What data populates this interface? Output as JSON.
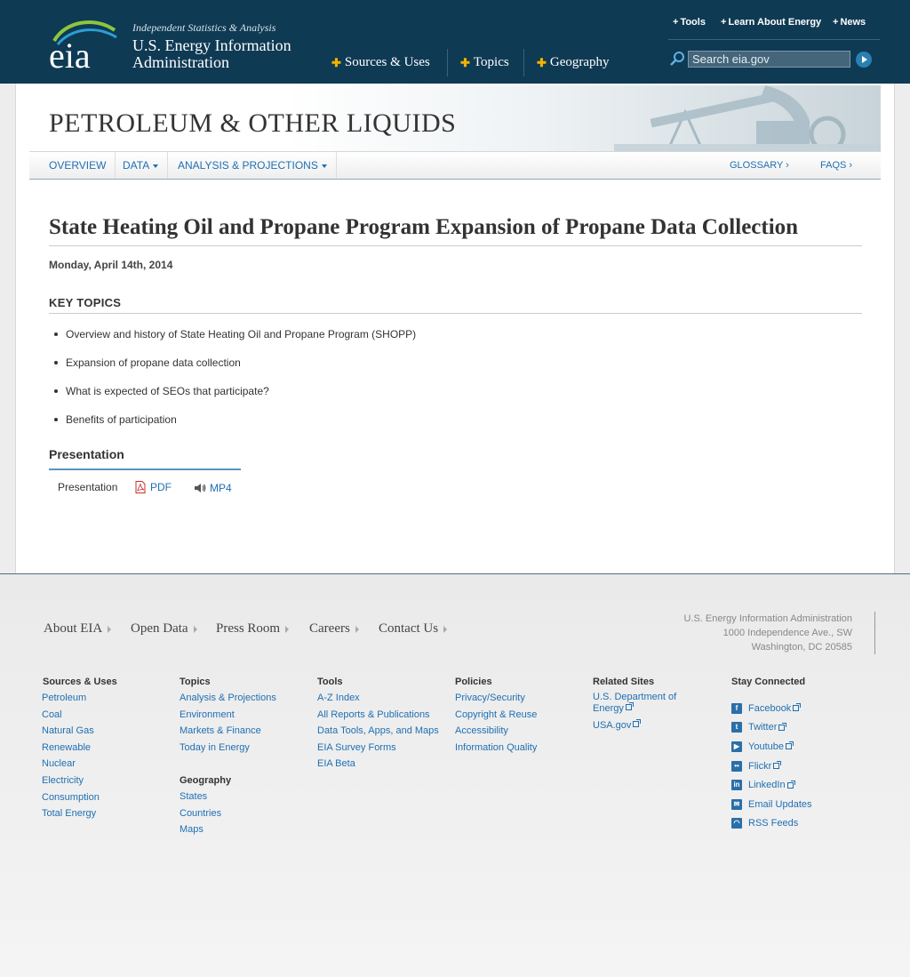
{
  "header": {
    "tagline": "Independent Statistics & Analysis",
    "org_name": "U.S. Energy Information Administration",
    "logo_text": "eia",
    "main_nav": [
      {
        "label": "Sources & Uses"
      },
      {
        "label": "Topics"
      },
      {
        "label": "Geography"
      }
    ],
    "top_links": [
      {
        "label": "Tools"
      },
      {
        "label": "Learn About Energy"
      },
      {
        "label": "News"
      }
    ],
    "search": {
      "placeholder": "Search eia.gov"
    }
  },
  "banner": {
    "title": "PETROLEUM & OTHER LIQUIDS"
  },
  "subnav": {
    "items": [
      {
        "label": "OVERVIEW"
      },
      {
        "label": "DATA"
      },
      {
        "label": "ANALYSIS & PROJECTIONS"
      }
    ],
    "glossary": "GLOSSARY ›",
    "faqs": "FAQS ›"
  },
  "article": {
    "title": "State Heating Oil and Propane Program Expansion of Propane Data Collection",
    "date": "Monday, April 14th, 2014",
    "key_topics_heading": "KEY TOPICS",
    "key_topics": [
      "Overview and history of State Heating Oil and Propane Program (SHOPP)",
      "Expansion of propane data collection",
      "What is expected of SEOs that participate?",
      "Benefits of participation"
    ],
    "presentation_heading": "Presentation",
    "presentation_label": "Presentation",
    "pdf_label": "PDF",
    "mp4_label": "MP4"
  },
  "footer": {
    "links": [
      {
        "label": "About EIA"
      },
      {
        "label": "Open Data"
      },
      {
        "label": "Press Room"
      },
      {
        "label": "Careers"
      },
      {
        "label": "Contact Us"
      }
    ],
    "address": {
      "line1": "U.S. Energy Information Administration",
      "line2": "1000 Independence Ave., SW",
      "line3": "Washington, DC 20585"
    },
    "columns": [
      {
        "heading": "Sources & Uses",
        "items": [
          "Petroleum",
          "Coal",
          "Natural Gas",
          "Renewable",
          "Nuclear",
          "Electricity",
          "Consumption",
          "Total Energy"
        ]
      },
      {
        "heading": "Topics",
        "items": [
          "Analysis & Projections",
          "Environment",
          "Markets & Finance",
          "Today in Energy"
        ]
      },
      {
        "heading": "Geography",
        "items": [
          "States",
          "Countries",
          "Maps"
        ]
      },
      {
        "heading": "Tools",
        "items": [
          "A-Z Index",
          "All Reports & Publications",
          "Data Tools, Apps, and Maps",
          "EIA Survey Forms",
          "EIA Beta"
        ]
      },
      {
        "heading": "Policies",
        "items": [
          "Privacy/Security",
          "Copyright & Reuse",
          "Accessibility",
          "Information Quality"
        ]
      },
      {
        "heading": "Related Sites",
        "items": [
          "U.S. Department of Energy",
          "USA.gov"
        ]
      }
    ],
    "stay_connected": {
      "heading": "Stay Connected",
      "items": [
        {
          "label": "Facebook",
          "icon": "facebook-icon"
        },
        {
          "label": "Twitter",
          "icon": "twitter-icon"
        },
        {
          "label": "Youtube",
          "icon": "youtube-icon"
        },
        {
          "label": "Flickr",
          "icon": "flickr-icon"
        },
        {
          "label": "LinkedIn",
          "icon": "linkedin-icon"
        },
        {
          "label": "Email Updates",
          "icon": "email-icon"
        },
        {
          "label": "RSS Feeds",
          "icon": "rss-icon"
        }
      ]
    }
  },
  "colors": {
    "header_bg": "#0f3a54",
    "accent_yellow": "#f2b300",
    "link_blue": "#1f6fb2"
  }
}
